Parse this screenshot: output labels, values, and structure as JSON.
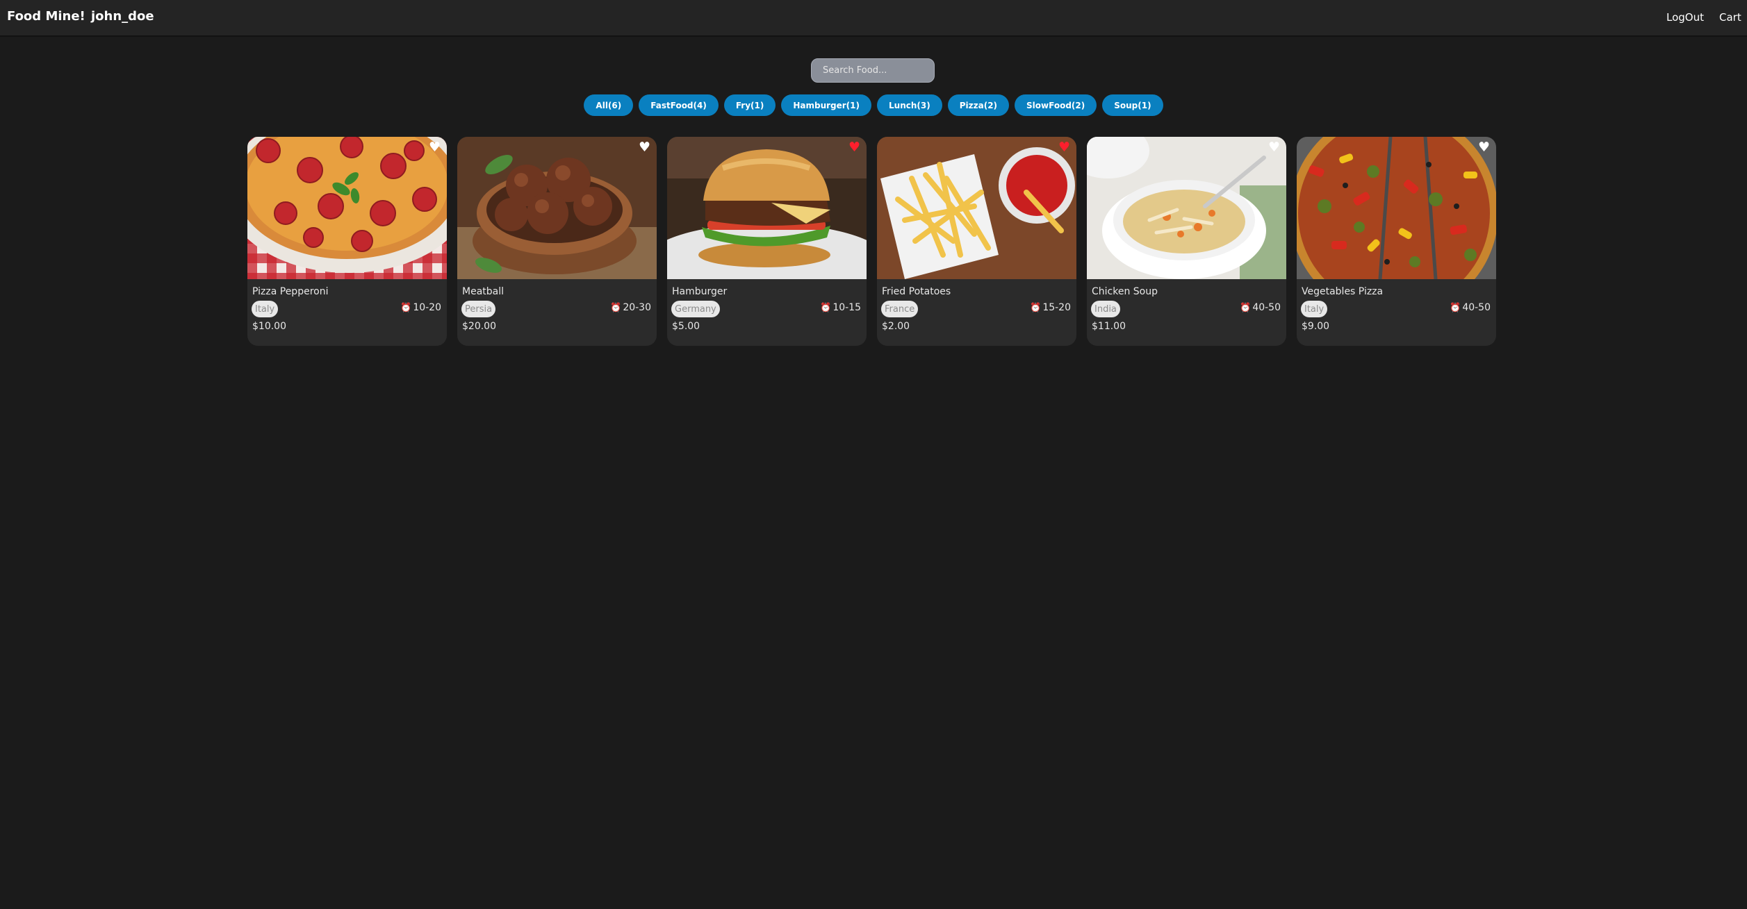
{
  "header": {
    "brand": "Food Mine!",
    "username": "john_doe",
    "links": [
      "LogOut",
      "Cart"
    ]
  },
  "search": {
    "placeholder": "Search Food..."
  },
  "tags": [
    "All(6)",
    "FastFood(4)",
    "Fry(1)",
    "Hamburger(1)",
    "Lunch(3)",
    "Pizza(2)",
    "SlowFood(2)",
    "Soup(1)"
  ],
  "foods": [
    {
      "name": "Pizza Pepperoni",
      "origin": "Italy",
      "cook_time": "10-20",
      "price": "$10.00",
      "favorite": false,
      "icon": "pizza-pepperoni-image"
    },
    {
      "name": "Meatball",
      "origin": "Persia",
      "cook_time": "20-30",
      "price": "$20.00",
      "favorite": false,
      "icon": "meatball-image"
    },
    {
      "name": "Hamburger",
      "origin": "Germany",
      "cook_time": "10-15",
      "price": "$5.00",
      "favorite": true,
      "icon": "hamburger-image"
    },
    {
      "name": "Fried Potatoes",
      "origin": "France",
      "cook_time": "15-20",
      "price": "$2.00",
      "favorite": true,
      "icon": "fried-potatoes-image"
    },
    {
      "name": "Chicken Soup",
      "origin": "India",
      "cook_time": "40-50",
      "price": "$11.00",
      "favorite": false,
      "icon": "chicken-soup-image"
    },
    {
      "name": "Vegetables Pizza",
      "origin": "Italy",
      "cook_time": "40-50",
      "price": "$9.00",
      "favorite": false,
      "icon": "vegetables-pizza-image"
    }
  ],
  "colors": {
    "background": "#1b1b1b",
    "header": "#242424",
    "card": "#2b2b2b",
    "tag": "#0a80c0",
    "favorite_on": "#ff1f2d",
    "clock": "#ff5a3c"
  }
}
